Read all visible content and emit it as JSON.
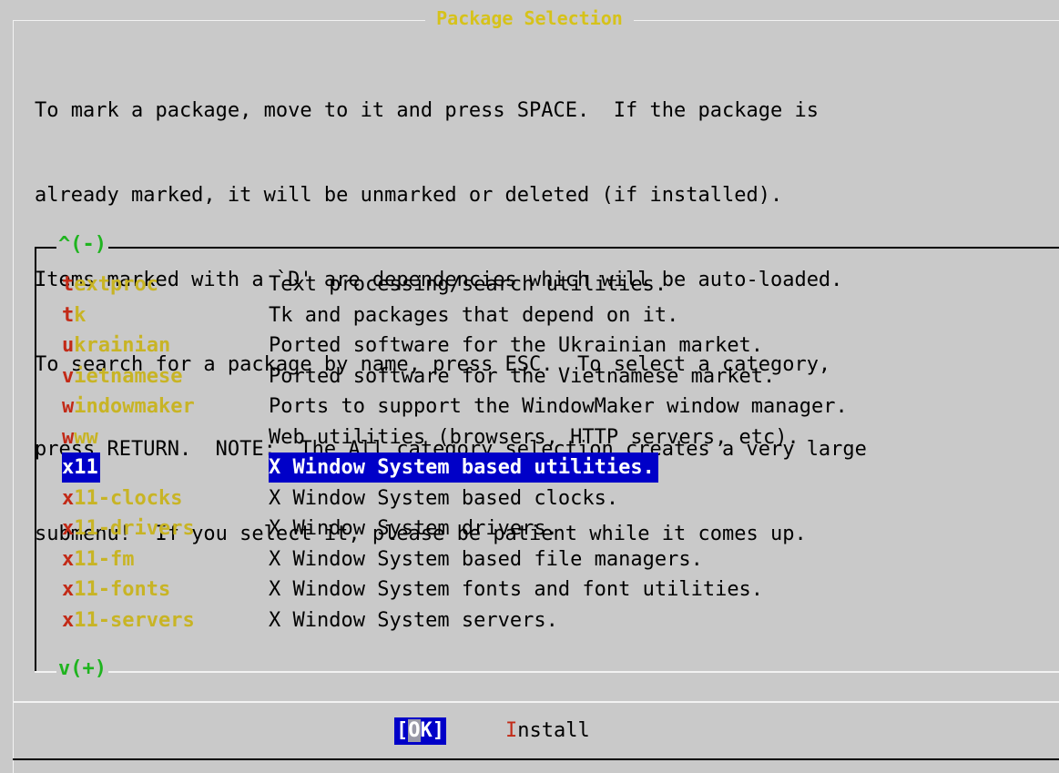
{
  "dialog": {
    "title": "Package Selection",
    "instructions": [
      "To mark a package, move to it and press SPACE.  If the package is",
      "already marked, it will be unmarked or deleted (if installed).",
      "Items marked with a `D' are dependencies which will be auto-loaded.",
      "To search for a package by name, press ESC.  To select a category,",
      "press RETURN.  NOTE:  The All category selection creates a very large",
      "submenu!  If you select it, please be patient while it comes up."
    ]
  },
  "list": {
    "scroll_up": "^(-)",
    "scroll_down": "v(+)",
    "selected_index": 6,
    "items": [
      {
        "hotkey": "t",
        "rest": "extproc",
        "description": "Text processing/search utilities."
      },
      {
        "hotkey": "t",
        "rest": "k",
        "description": "Tk and packages that depend on it."
      },
      {
        "hotkey": "u",
        "rest": "krainian",
        "description": "Ported software for the Ukrainian market."
      },
      {
        "hotkey": "v",
        "rest": "ietnamese",
        "description": "Ported software for the Vietnamese market."
      },
      {
        "hotkey": "w",
        "rest": "indowmaker",
        "description": "Ports to support the WindowMaker window manager."
      },
      {
        "hotkey": "w",
        "rest": "ww",
        "description": "Web utilities (browsers, HTTP servers, etc)."
      },
      {
        "hotkey": "x",
        "rest": "11",
        "description": "X Window System based utilities."
      },
      {
        "hotkey": "x",
        "rest": "11-clocks",
        "description": "X Window System based clocks."
      },
      {
        "hotkey": "x",
        "rest": "11-drivers",
        "description": "X Window System drivers."
      },
      {
        "hotkey": "x",
        "rest": "11-fm",
        "description": "X Window System based file managers."
      },
      {
        "hotkey": "x",
        "rest": "11-fonts",
        "description": "X Window System fonts and font utilities."
      },
      {
        "hotkey": "x",
        "rest": "11-servers",
        "description": "X Window System servers."
      }
    ]
  },
  "buttons": {
    "ok": {
      "open": "[",
      "hotkey": "O",
      "rest": "K]"
    },
    "install": {
      "hotkey": "I",
      "rest": "nstall"
    }
  },
  "colors": {
    "background": "#c9c9c9",
    "title": "#d6c21a",
    "category": "#c8b425",
    "hotkey": "#c22a17",
    "scroll_indicator": "#1fb41f",
    "selection": "#0000c8"
  }
}
